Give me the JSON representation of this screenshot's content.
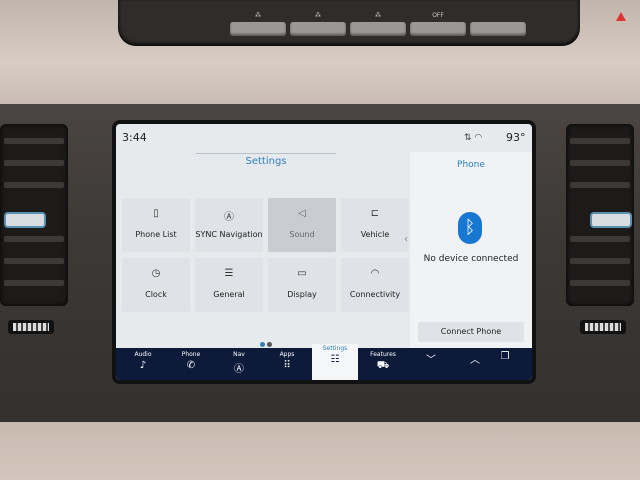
{
  "hvac": {
    "buttons": [
      {
        "label": "⁂",
        "icon": "defrost-front-icon"
      },
      {
        "label": "⁂",
        "icon": "defrost-max-icon"
      },
      {
        "label": "⁂",
        "icon": "defrost-rear-icon"
      },
      {
        "label": "OFF",
        "icon": "auto-stop-icon"
      },
      {
        "label": "",
        "icon": "hazard-icon"
      }
    ]
  },
  "status": {
    "time": "3:44",
    "temperature": "93°",
    "icons": [
      "signal-icon",
      "wifi-icon"
    ]
  },
  "settings": {
    "title": "Settings",
    "tiles": [
      {
        "label": "Phone List",
        "icon": "phone-list-icon"
      },
      {
        "label": "SYNC Navigation",
        "icon": "navigation-icon"
      },
      {
        "label": "Sound",
        "icon": "speaker-icon"
      },
      {
        "label": "Vehicle",
        "icon": "vehicle-icon"
      },
      {
        "label": "Clock",
        "icon": "clock-icon"
      },
      {
        "label": "General",
        "icon": "sliders-icon"
      },
      {
        "label": "Display",
        "icon": "display-icon"
      },
      {
        "label": "Connectivity",
        "icon": "wifi-icon"
      }
    ],
    "page_dots": 2,
    "active_page": 1
  },
  "phone_panel": {
    "title": "Phone",
    "status": "No device connected",
    "connect_label": "Connect Phone"
  },
  "navbar": [
    {
      "label": "Audio",
      "icon": "music-note-icon"
    },
    {
      "label": "Phone",
      "icon": "phone-icon"
    },
    {
      "label": "Nav",
      "icon": "navigation-icon"
    },
    {
      "label": "Apps",
      "icon": "apps-grid-icon"
    },
    {
      "label": "Settings",
      "icon": "settings-sliders-icon",
      "active": true
    },
    {
      "label": "Features",
      "icon": "car-features-icon"
    },
    {
      "label": "",
      "icon": "chevron-down-icon"
    },
    {
      "label": "",
      "icon": "chevron-up-icon"
    },
    {
      "label": "",
      "icon": "windows-icon"
    }
  ],
  "colors": {
    "accent": "#2c7fbf",
    "navbar": "#0d1a3a",
    "bluetooth": "#1877d1"
  }
}
